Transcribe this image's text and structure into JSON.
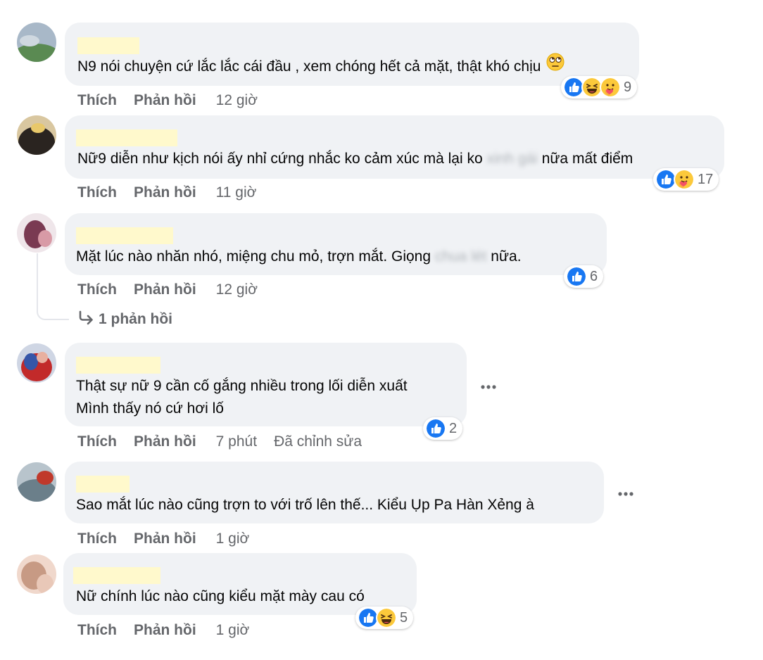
{
  "comments": [
    {
      "text": "N9 nói chuyện cứ lắc lắc cái đầu , xem chóng hết cả mặt, thật khó chịu",
      "emoji": "face-with-rolling-eyes-emoji",
      "actions": {
        "like": "Thích",
        "reply": "Phản hồi",
        "time": "12 giờ"
      },
      "reactions": {
        "icons": [
          "like-reaction-icon",
          "laugh-reaction-icon",
          "care-reaction-icon"
        ],
        "count": "9"
      }
    },
    {
      "text_before": "Nữ9 diễn như kịch nói ấy nhỉ cứng nhắc ko cảm xúc mà lại ko ",
      "blurred": "xinh gái",
      "text_after": " nữa mất điểm",
      "actions": {
        "like": "Thích",
        "reply": "Phản hồi",
        "time": "11 giờ"
      },
      "reactions": {
        "icons": [
          "like-reaction-icon",
          "care-reaction-icon"
        ],
        "count": "17"
      }
    },
    {
      "text_before": "Mặt lúc nào nhăn nhó, miệng chu mỏ, trợn mắt. Giọng ",
      "blurred": "chua lét",
      "text_after": " nữa.",
      "actions": {
        "like": "Thích",
        "reply": "Phản hồi",
        "time": "12 giờ"
      },
      "reactions": {
        "icons": [
          "like-reaction-icon"
        ],
        "count": "6"
      },
      "replies_link": "1 phản hồi"
    },
    {
      "line1": "Thật sự nữ 9 cần cố gắng nhiều trong lối diễn xuất",
      "line2": "Mình thấy nó cứ hơi lố",
      "actions": {
        "like": "Thích",
        "reply": "Phản hồi",
        "time": "7 phút",
        "edited": "Đã chỉnh sửa"
      },
      "reactions": {
        "icons": [
          "like-reaction-icon"
        ],
        "count": "2"
      }
    },
    {
      "text": "Sao mắt lúc nào cũng trợn to với trố lên thế... Kiểu Ụp Pa Hàn Xẻng à",
      "actions": {
        "like": "Thích",
        "reply": "Phản hồi",
        "time": "1 giờ"
      }
    },
    {
      "text": "Nữ chính lúc nào cũng kiểu mặt mày cau có",
      "actions": {
        "like": "Thích",
        "reply": "Phản hồi",
        "time": "1 giờ"
      },
      "reactions": {
        "icons": [
          "like-reaction-icon",
          "laugh-reaction-icon"
        ],
        "count": "5"
      }
    }
  ],
  "colors": {
    "bubble": "#f0f2f5",
    "name_redaction": "#fff9cc",
    "secondary_text": "#65676b",
    "like_blue": "#1877f2",
    "emoji_yellow": "#fcc93b"
  }
}
